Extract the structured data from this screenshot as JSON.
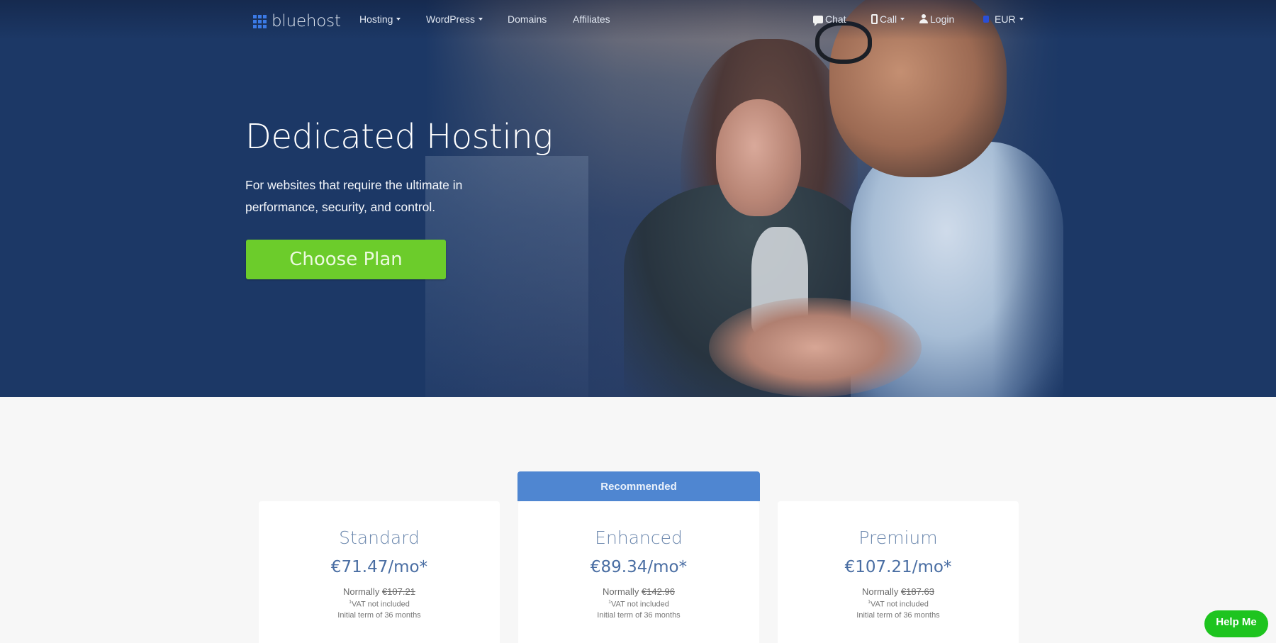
{
  "brand": {
    "name": "bluehost",
    "accent": "#3b7ae6"
  },
  "nav": {
    "left": [
      {
        "label": "Hosting",
        "dropdown": true
      },
      {
        "label": "WordPress",
        "dropdown": true
      },
      {
        "label": "Domains",
        "dropdown": false
      },
      {
        "label": "Affiliates",
        "dropdown": false
      }
    ],
    "right": {
      "chat": {
        "label": "Chat",
        "icon": "chat-bubble-icon"
      },
      "call": {
        "label": "Call",
        "icon": "phone-icon",
        "dropdown": true
      },
      "login": {
        "label": "Login",
        "icon": "user-icon"
      },
      "currency": {
        "label": "EUR",
        "icon": "flag-icon",
        "dropdown": true
      }
    }
  },
  "hero": {
    "title": "Dedicated Hosting",
    "subtitle": "For websites that require the ultimate in performance, security, and control.",
    "cta_label": "Choose Plan",
    "cta_color": "#6ccc2b",
    "background_color": "#1c3866"
  },
  "pricing": {
    "recommended_label": "Recommended",
    "recommended_color": "#4f86d1",
    "plans": [
      {
        "name": "Standard",
        "price": "€71.47/mo*",
        "normally_label": "Normally",
        "normal_price": "€107.21",
        "vat_mark": "1",
        "vat_note": "VAT not included",
        "term": "Initial term of 36 months",
        "recommended": false
      },
      {
        "name": "Enhanced",
        "price": "€89.34/mo*",
        "normally_label": "Normally",
        "normal_price": "€142.96",
        "vat_mark": "1",
        "vat_note": "VAT not included",
        "term": "Initial term of 36 months",
        "recommended": true
      },
      {
        "name": "Premium",
        "price": "€107.21/mo*",
        "normally_label": "Normally",
        "normal_price": "€187.63",
        "vat_mark": "1",
        "vat_note": "VAT not included",
        "term": "Initial term of 36 months",
        "recommended": false
      }
    ]
  },
  "help_button": {
    "label": "Help Me",
    "color": "#1ec41f"
  }
}
